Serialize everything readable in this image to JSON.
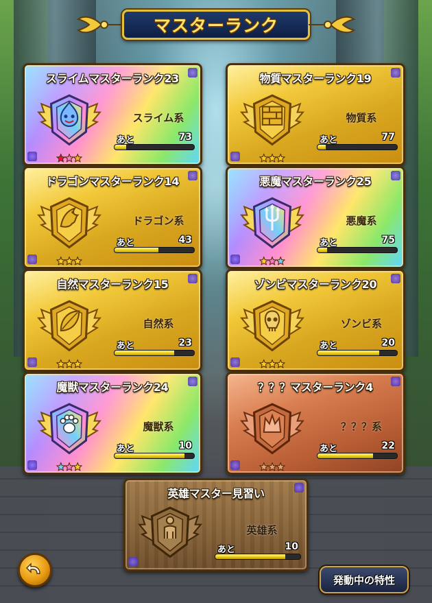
{
  "header": {
    "title": "マスターランク"
  },
  "ato_label": "あと",
  "ranks": [
    {
      "title": "スライムマスターランク23",
      "category": "スライム系",
      "remaining": "73",
      "progress": 0.15,
      "style": "rainbow",
      "emblem_icon": "slime-icon",
      "star_colors": [
        "#e14",
        "#f7c",
        "#fa3"
      ]
    },
    {
      "title": "物質マスターランク19",
      "category": "物質系",
      "remaining": "77",
      "progress": 0.1,
      "style": "gold",
      "emblem_icon": "brick-wall-icon",
      "star_colors": [
        "#fc2",
        "#fc2",
        "#fc2"
      ]
    },
    {
      "title": "ドラゴンマスターランク14",
      "category": "ドラゴン系",
      "remaining": "43",
      "progress": 0.55,
      "style": "gold",
      "emblem_icon": "dragon-icon",
      "star_colors": [
        "#fc2",
        "#fc2",
        "#fc2"
      ]
    },
    {
      "title": "悪魔マスターランク25",
      "category": "悪魔系",
      "remaining": "75",
      "progress": 0.12,
      "style": "rainbow",
      "emblem_icon": "trident-icon",
      "star_colors": [
        "#fc2",
        "#f7c",
        "#7cf"
      ]
    },
    {
      "title": "自然マスターランク15",
      "category": "自然系",
      "remaining": "23",
      "progress": 0.75,
      "style": "gold",
      "emblem_icon": "leaf-icon",
      "star_colors": [
        "#fc2",
        "#fc2",
        "#fc2"
      ]
    },
    {
      "title": "ゾンビマスターランク20",
      "category": "ゾンビ系",
      "remaining": "20",
      "progress": 0.78,
      "style": "gold",
      "emblem_icon": "skull-icon",
      "star_colors": [
        "#fc2",
        "#fc2",
        "#fc2"
      ]
    },
    {
      "title": "魔獣マスターランク24",
      "category": "魔獣系",
      "remaining": "10",
      "progress": 0.88,
      "style": "rainbow",
      "emblem_icon": "paw-icon",
      "star_colors": [
        "#7cf",
        "#f7c",
        "#fc2"
      ]
    },
    {
      "title": "？？？マスターランク4",
      "category": "？？？系",
      "remaining": "22",
      "progress": 0.7,
      "style": "bronze",
      "emblem_icon": "crown-icon",
      "star_colors": [
        "#e9a07a",
        "#e9a07a",
        "#e9a07a"
      ]
    },
    {
      "title": "英雄マスター見習い",
      "category": "英雄系",
      "remaining": "10",
      "progress": 0.82,
      "style": "wood",
      "emblem_icon": "hero-figure-icon",
      "star_colors": []
    }
  ],
  "buttons": {
    "trait": "発動中の特性",
    "back_icon": "back-arrow-icon"
  },
  "colors": {
    "gold": "#f2c93a",
    "bronze": "#d77c4e",
    "wood": "#8a653a",
    "bar_fill": "#e8c816"
  }
}
